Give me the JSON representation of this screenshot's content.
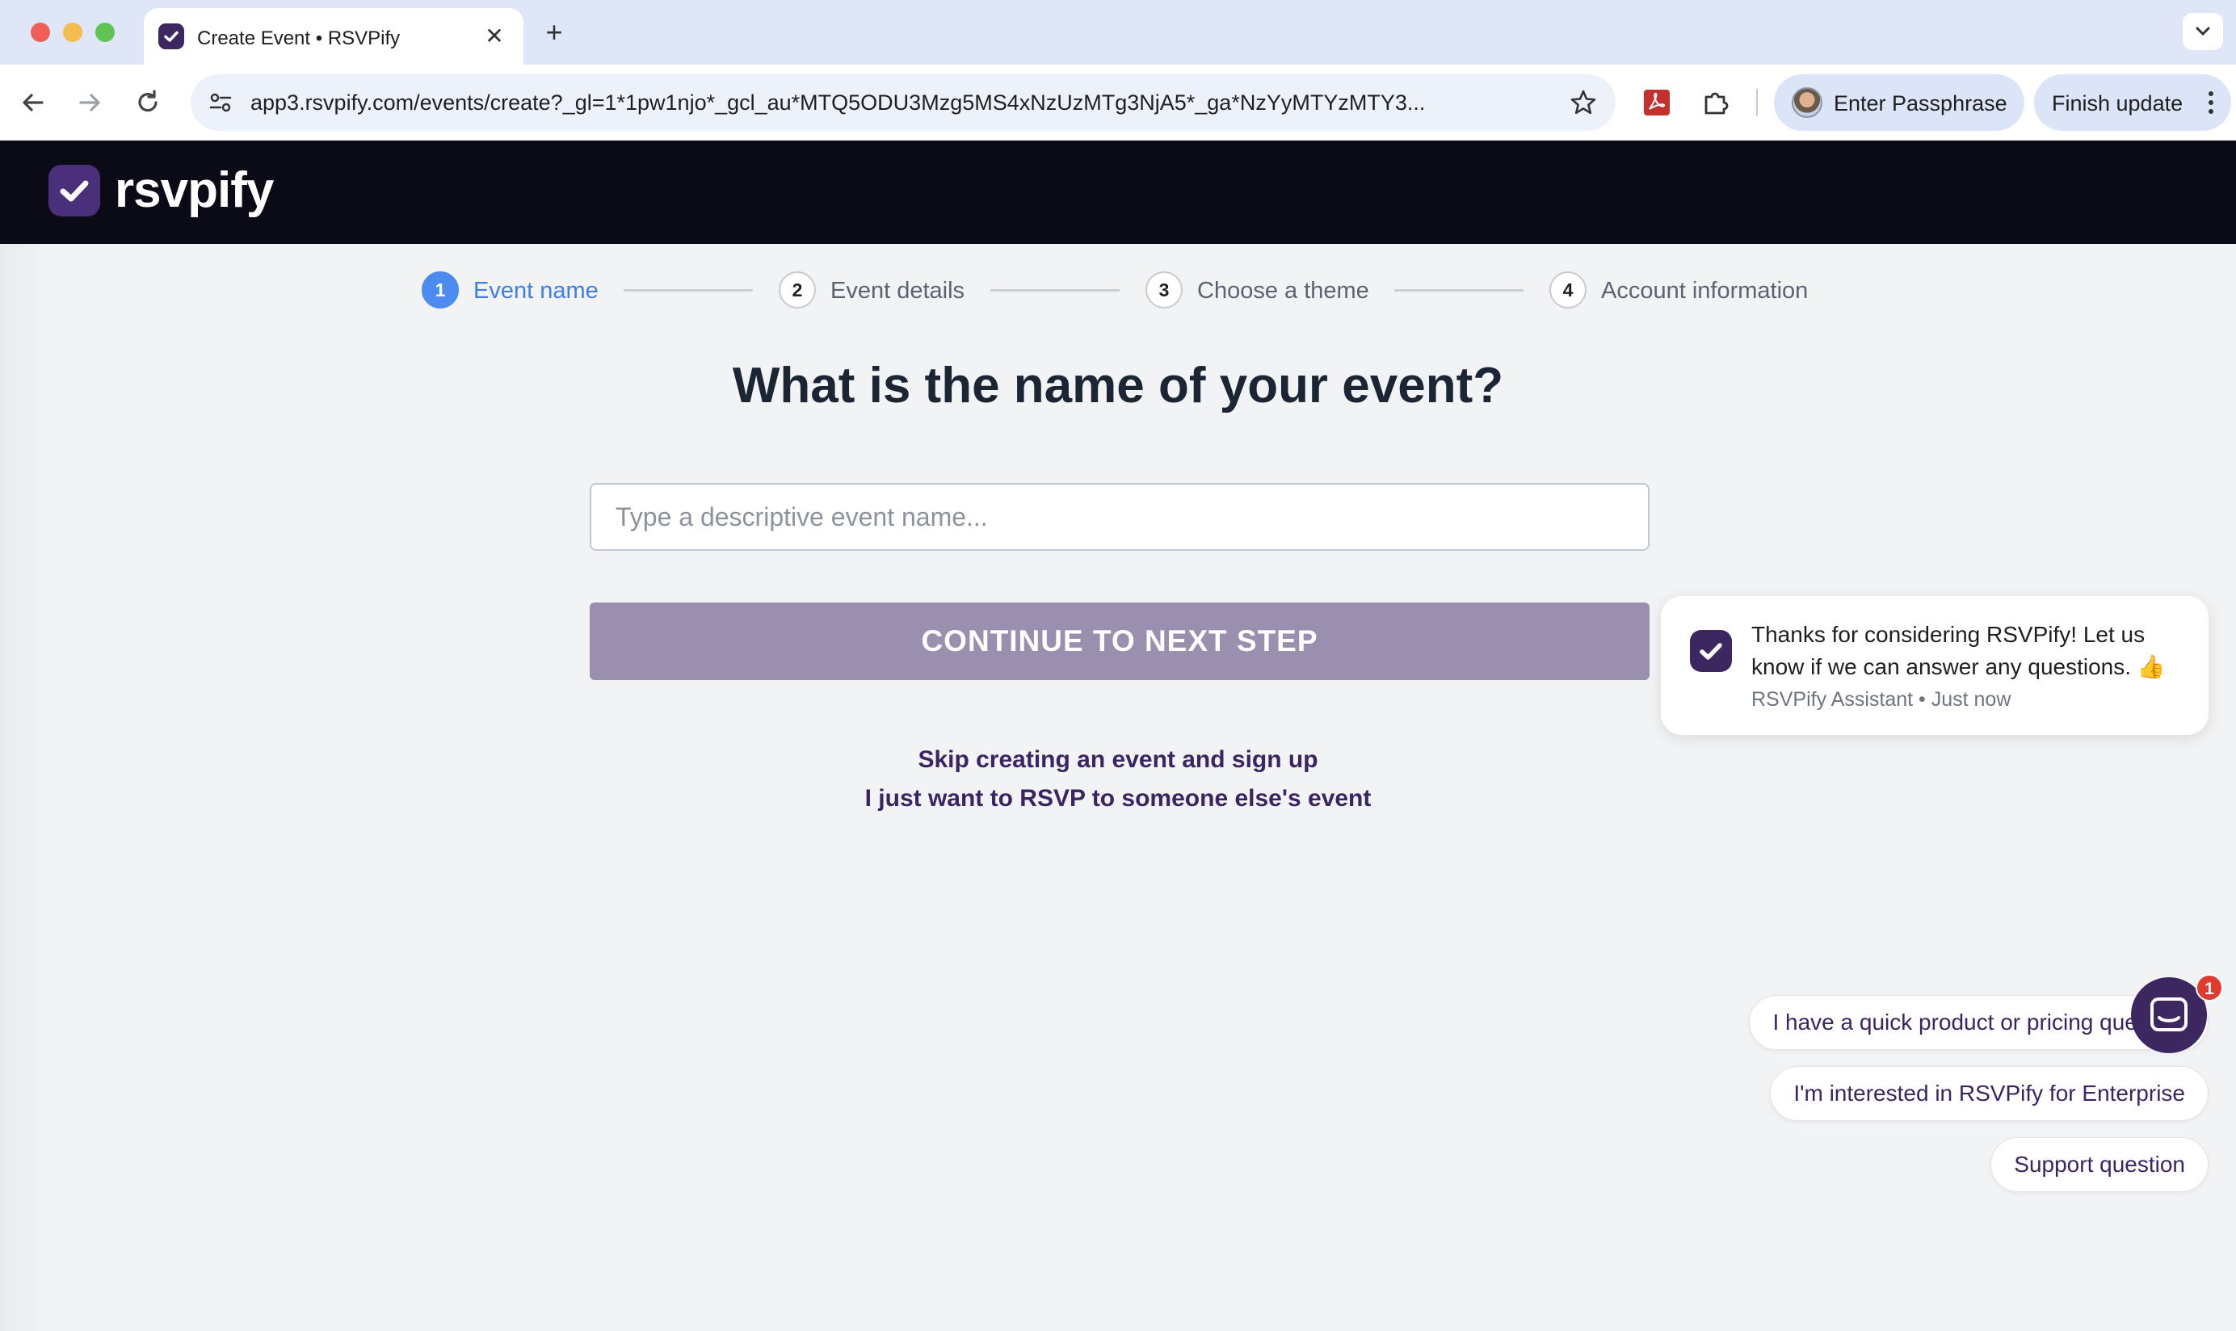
{
  "browser": {
    "tab_title": "Create Event • RSVPify",
    "close_glyph": "✕",
    "new_tab_glyph": "+",
    "url": "app3.rsvpify.com/events/create?_gl=1*1pw1njo*_gcl_au*MTQ5ODU3Mzg5MS4xNzUzMTg3NjA5*_ga*NzYyMTYzMTY3...",
    "passphrase_label": "Enter Passphrase",
    "finish_update_label": "Finish update",
    "colors": {
      "tabbar": "#dfe6f7",
      "pdf_ext": "#c4302b"
    }
  },
  "app": {
    "logo_text": "rsvpify",
    "brand_color": "#3d2760"
  },
  "stepper": {
    "steps": [
      {
        "number": "1",
        "label": "Event name",
        "active": true
      },
      {
        "number": "2",
        "label": "Event details",
        "active": false
      },
      {
        "number": "3",
        "label": "Choose a theme",
        "active": false
      },
      {
        "number": "4",
        "label": "Account information",
        "active": false
      }
    ]
  },
  "form": {
    "question": "What is the name of your event?",
    "input_placeholder": "Type a descriptive event name...",
    "input_value": "",
    "continue_label": "CONTINUE TO NEXT STEP"
  },
  "links": {
    "skip": "Skip creating an event and sign up",
    "rsvp_other": "I just want to RSVP to someone else's event"
  },
  "chat": {
    "message": "Thanks for considering RSVPify! Let us know if we can answer any questions. 👍",
    "meta": "RSVPify Assistant • Just now",
    "options": [
      "I have a quick product or pricing question",
      "I'm interested in RSVPify for Enterprise",
      "Support question"
    ],
    "badge_count": "1"
  }
}
